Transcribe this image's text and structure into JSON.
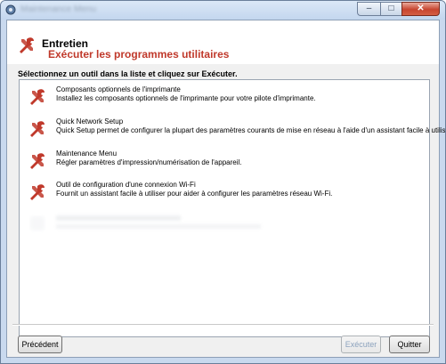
{
  "window": {
    "title": "Maintenance Menu",
    "controls": {
      "minimize": "–",
      "maximize": "□",
      "close": "✕"
    }
  },
  "header": {
    "title": "Entretien",
    "subtitle": "Exécuter les programmes utilitaires",
    "icon": "tools-icon"
  },
  "instruction": "Sélectionnez un outil dans la liste et cliquez sur Exécuter.",
  "tools": [
    {
      "name": "Composants optionnels de l'imprimante",
      "description": "Installez les composants optionnels de l'imprimante pour votre pilote d'imprimante.",
      "icon": "tools-icon"
    },
    {
      "name": "Quick Network Setup",
      "description": "Quick Setup permet de configurer la plupart des paramètres courants de mise en réseau à l'aide d'un assistant facile à utiliser.",
      "icon": "tools-icon"
    },
    {
      "name": "Maintenance Menu",
      "description": "Régler paramètres d'impression/numérisation de l'appareil.",
      "icon": "tools-icon"
    },
    {
      "name": "Outil de configuration d'une connexion Wi-Fi",
      "description": "Fournit un assistant facile à utiliser pour aider à configurer les paramètres réseau Wi-Fi.",
      "icon": "tools-icon"
    }
  ],
  "buttons": {
    "previous": "Précédent",
    "execute": "Exécuter",
    "quit": "Quitter"
  },
  "colors": {
    "accent": "#c0392b",
    "disabled_text": "#8da3be"
  }
}
